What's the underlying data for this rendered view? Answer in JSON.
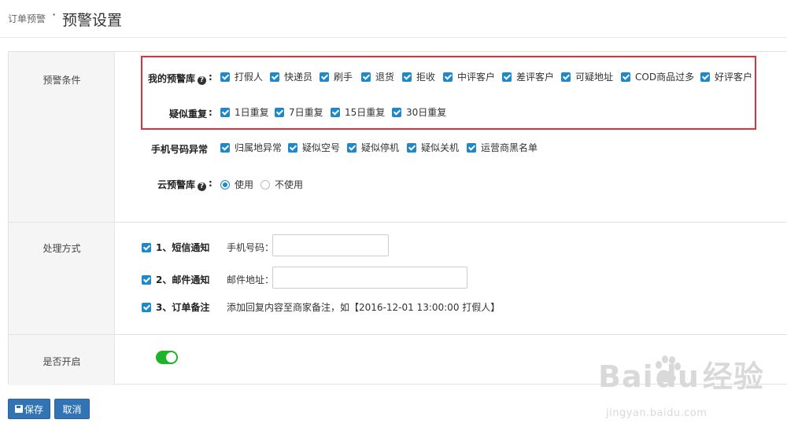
{
  "header": {
    "breadcrumb": "订单预警",
    "separator": "·",
    "title": "预警设置"
  },
  "conditions": {
    "section_label": "预警条件",
    "my_library": {
      "label": "我的预警库",
      "colon": ":",
      "options": [
        "打假人",
        "快递员",
        "刷手",
        "退货",
        "拒收",
        "中评客户",
        "差评客户",
        "可疑地址",
        "COD商品过多",
        "好评客户"
      ]
    },
    "suspect_repeat": {
      "label": "疑似重复",
      "colon": ":",
      "options": [
        "1日重复",
        "7日重复",
        "15日重复",
        "30日重复"
      ]
    },
    "phone_abnormal": {
      "label": "手机号码异常",
      "options": [
        "归属地异常",
        "疑似空号",
        "疑似停机",
        "疑似关机",
        "运营商黑名单"
      ]
    },
    "cloud_library": {
      "label": "云预警库",
      "colon": ":",
      "options": [
        "使用",
        "不使用"
      ],
      "selected": "使用"
    }
  },
  "methods": {
    "section_label": "处理方式",
    "sms": {
      "label": "1、短信通知",
      "field_label": "手机号码：",
      "value": ""
    },
    "email": {
      "label": "2、邮件通知",
      "field_label": "邮件地址：",
      "value": ""
    },
    "remark": {
      "label": "3、订单备注",
      "note": "添加回复内容至商家备注，如【2016-12-01 13:00:00 打假人】"
    }
  },
  "enable": {
    "section_label": "是否开启",
    "on": true
  },
  "buttons": {
    "save": "保存",
    "cancel": "取消"
  },
  "watermark": {
    "brand": "Bai",
    "brand2": "du",
    "cn": "经验",
    "url": "jingyan.baidu.com"
  },
  "colors": {
    "accent": "#1e88c8",
    "highlight_border": "#e0303b",
    "toggle_on": "#1db42a",
    "button": "#3173b3"
  }
}
